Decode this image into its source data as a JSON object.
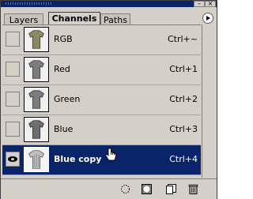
{
  "panel": {
    "tabs": [
      {
        "label": "Layers",
        "active": false
      },
      {
        "label": "Channels",
        "active": true
      },
      {
        "label": "Paths",
        "active": false
      }
    ],
    "titlebar": {
      "minimize_icon": "minimize-icon",
      "close_icon": "close-icon"
    }
  },
  "channels": [
    {
      "name": "RGB",
      "shortcut": "Ctrl+~",
      "visible": false,
      "selected": false,
      "thumb_tone": "#8a8a64"
    },
    {
      "name": "Red",
      "shortcut": "Ctrl+1",
      "visible": false,
      "selected": false,
      "thumb_tone": "#7c7c7c"
    },
    {
      "name": "Green",
      "shortcut": "Ctrl+2",
      "visible": false,
      "selected": false,
      "thumb_tone": "#7c7c7c"
    },
    {
      "name": "Blue",
      "shortcut": "Ctrl+3",
      "visible": false,
      "selected": false,
      "thumb_tone": "#6e6e6e"
    },
    {
      "name": "Blue copy",
      "shortcut": "Ctrl+4",
      "visible": true,
      "selected": true,
      "thumb_tone": "#bfbfbf"
    }
  ],
  "bottom_icons": [
    "load-selection-icon",
    "save-selection-icon",
    "new-channel-icon",
    "delete-channel-icon"
  ],
  "colors": {
    "selection": "#0a246a",
    "panel_bg": "#d4d0c8"
  }
}
